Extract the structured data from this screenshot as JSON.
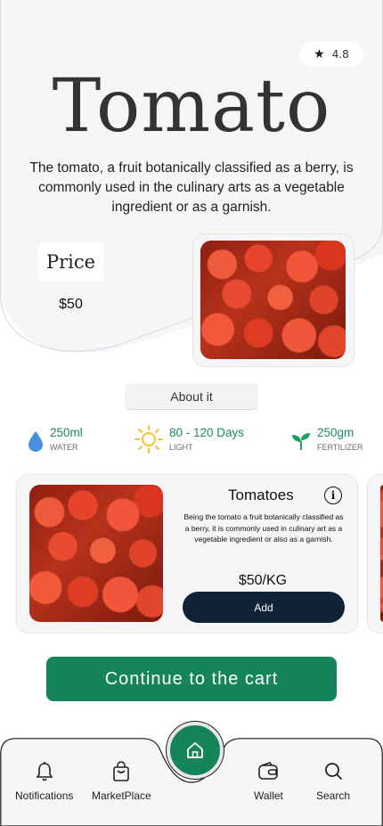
{
  "product": {
    "rating": "4.8",
    "title": "Tomato",
    "description": "The tomato, a fruit botanically classified as a berry, is commonly used in the culinary arts as a vegetable ingredient or as a garnish.",
    "price_label": "Price",
    "price_value": "$50"
  },
  "about": {
    "label": "About it"
  },
  "stats": [
    {
      "icon": "water-drop-icon",
      "value": "250ml",
      "label": "WATER",
      "color": "#4a90e2"
    },
    {
      "icon": "sun-icon",
      "value": "80 - 120 Days",
      "label": "LIGHT",
      "color": "#f2c230"
    },
    {
      "icon": "sprout-icon",
      "value": "250gm",
      "label": "FERTILIZER",
      "color": "#1fa463"
    }
  ],
  "card": {
    "name": "Tomatoes",
    "description": "Being the tomato a fruit botanically classified as a berry, it is commonly used in culinary art as a vegetable ingredient or also as a garnish.",
    "price": "$50/KG",
    "add_label": "Add"
  },
  "cta": {
    "label": "Continue to the cart"
  },
  "nav": {
    "items": [
      {
        "label": "Notifications",
        "icon": "bell-icon"
      },
      {
        "label": "MarketPlace",
        "icon": "shopping-bag-icon"
      },
      {
        "label": "Wallet",
        "icon": "wallet-icon"
      },
      {
        "label": "Search",
        "icon": "search-icon"
      }
    ],
    "home_icon": "home-icon"
  },
  "colors": {
    "accent_green": "#15845a",
    "dark_button": "#0f2238",
    "card_background": "#f6f6f9"
  }
}
